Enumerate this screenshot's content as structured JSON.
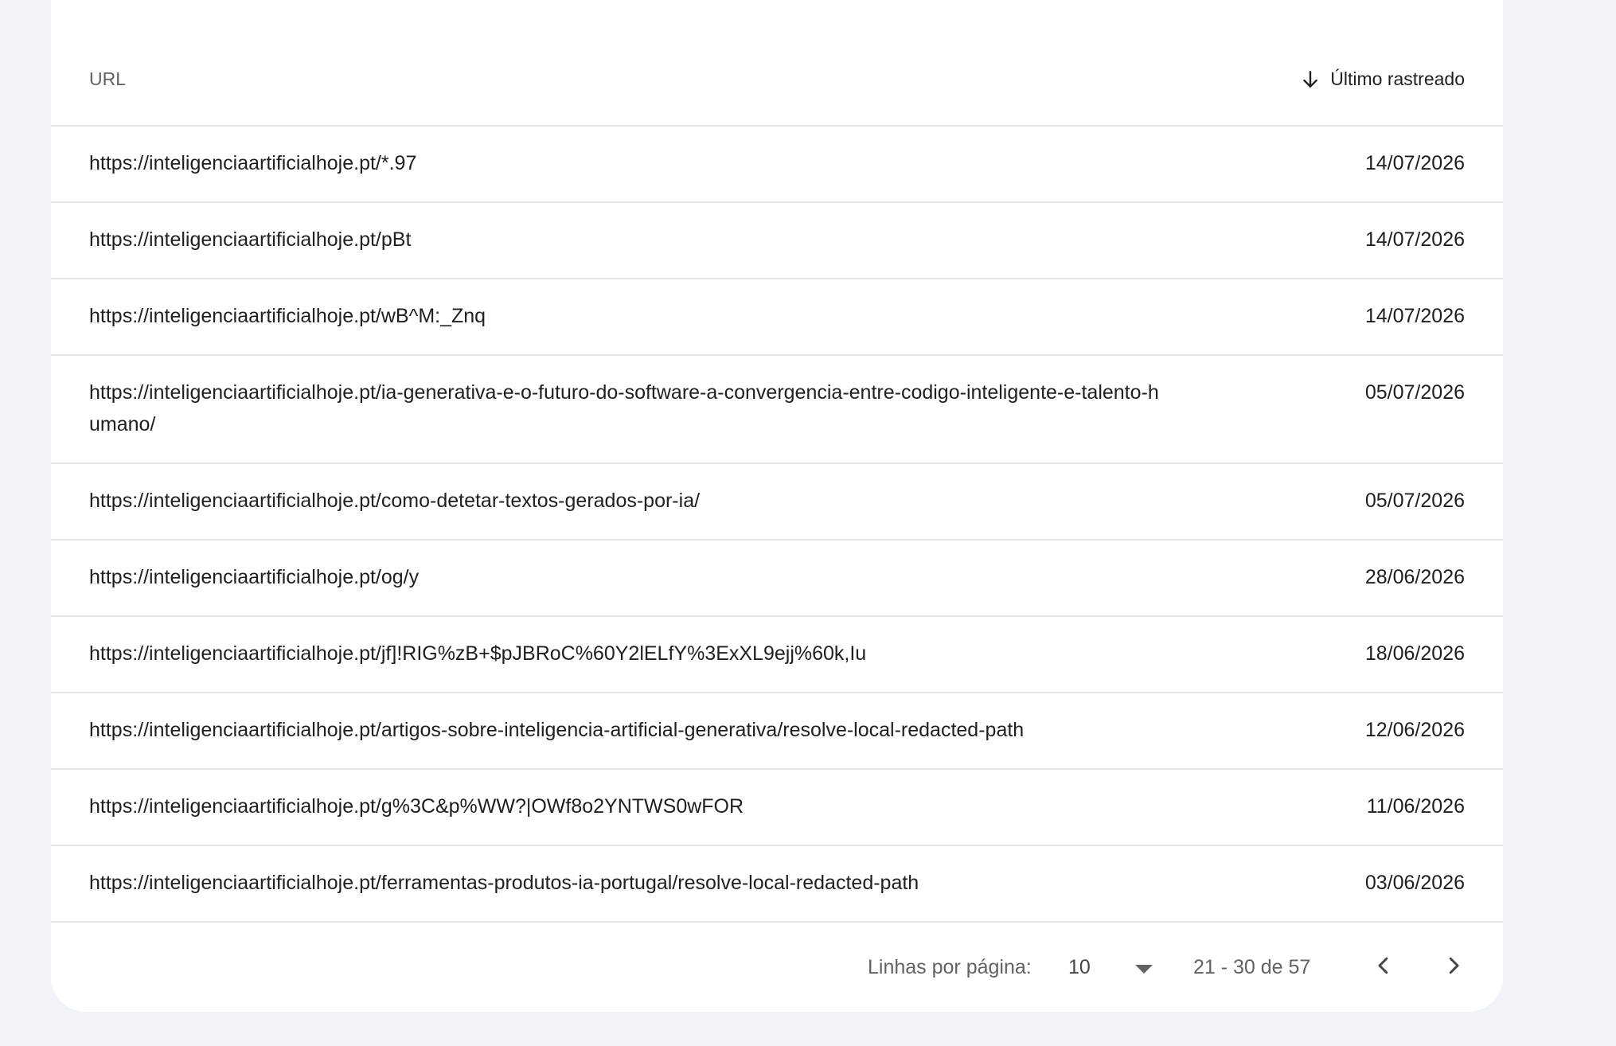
{
  "table": {
    "columns": {
      "url": "URL",
      "last_crawled": "Último rastreado"
    },
    "rows": [
      {
        "url": "https://inteligenciaartificialhoje.pt/*.97",
        "date": "14/07/2026"
      },
      {
        "url": "https://inteligenciaartificialhoje.pt/pBt",
        "date": "14/07/2026"
      },
      {
        "url": "https://inteligenciaartificialhoje.pt/wB^M:_Znq",
        "date": "14/07/2026"
      },
      {
        "url": "https://inteligenciaartificialhoje.pt/ia-generativa-e-o-futuro-do-software-a-convergencia-entre-codigo-inteligente-e-talento-humano/",
        "date": "05/07/2026"
      },
      {
        "url": "https://inteligenciaartificialhoje.pt/como-detetar-textos-gerados-por-ia/",
        "date": "05/07/2026"
      },
      {
        "url": "https://inteligenciaartificialhoje.pt/og/y",
        "date": "28/06/2026"
      },
      {
        "url": "https://inteligenciaartificialhoje.pt/jf]!RIG%zB+$pJBRoC%60Y2lELfY%3ExXL9ejj%60k,Iu",
        "date": "18/06/2026"
      },
      {
        "url": "https://inteligenciaartificialhoje.pt/artigos-sobre-inteligencia-artificial-generativa/resolve-local-redacted-path",
        "date": "12/06/2026"
      },
      {
        "url": "https://inteligenciaartificialhoje.pt/g%3C&p%WW?|OWf8o2YNTWS0wFOR",
        "date": "11/06/2026"
      },
      {
        "url": "https://inteligenciaartificialhoje.pt/ferramentas-produtos-ia-portugal/resolve-local-redacted-path",
        "date": "03/06/2026"
      }
    ]
  },
  "pagination": {
    "rows_per_page_label": "Linhas por página:",
    "rows_per_page_value": "10",
    "range_text": "21 - 30 de 57"
  },
  "icons": {
    "sort": "arrow-down-icon",
    "dropdown": "caret-down-icon",
    "prev": "chevron-left-icon",
    "next": "chevron-right-icon"
  }
}
